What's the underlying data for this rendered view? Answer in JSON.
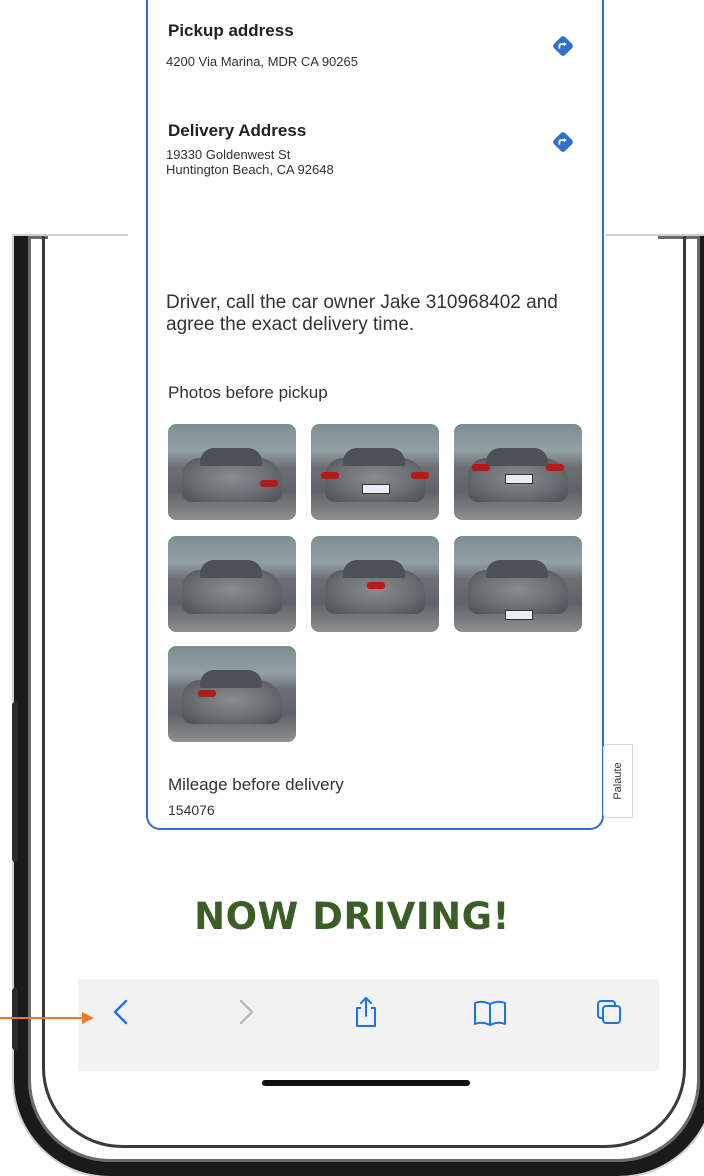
{
  "pickup": {
    "title": "Pickup address",
    "address": "4200 Via Marina, MDR CA 90265",
    "nav_icon": "directions-icon"
  },
  "delivery": {
    "title": "Delivery Address",
    "address_line1": "19330 Goldenwest St",
    "address_line2": "Huntington Beach, CA 92648",
    "nav_icon": "directions-icon"
  },
  "instructions": "Driver, call the car owner Jake 310968402 and agree the exact delivery time.",
  "photos": {
    "title": "Photos before pickup",
    "count": 7
  },
  "mileage": {
    "label": "Mileage before delivery",
    "value": "154076"
  },
  "feedback_tab": "Palaute",
  "banner": "NOW DRIVING!",
  "toolbar": {
    "items": [
      "back-icon",
      "forward-icon",
      "share-icon",
      "bookmarks-icon",
      "tabs-icon"
    ]
  },
  "colors": {
    "accent": "#2f6fd1",
    "banner": "#3a5e26",
    "toolbar_tint": "#1a73e8",
    "annotation_arrow": "#ea7a2b"
  }
}
